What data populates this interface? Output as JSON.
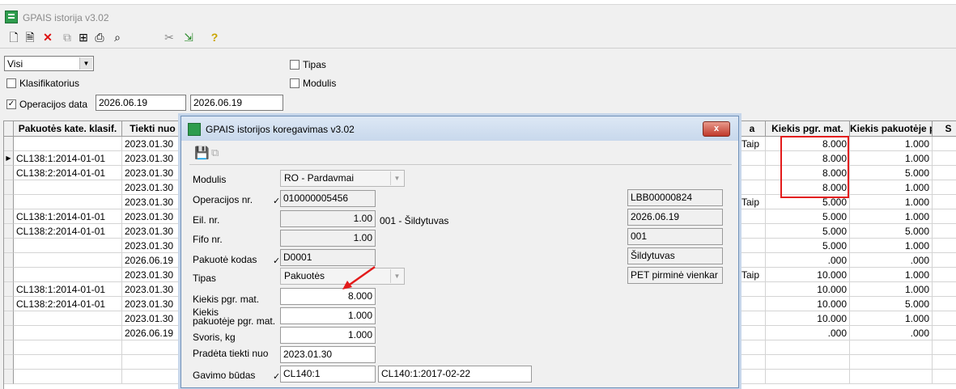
{
  "app": {
    "title": "GPAIS istorija v3.02",
    "toolbar_icons": [
      "new-icon",
      "document-icon",
      "delete-icon",
      "copy-icon",
      "tree-icon",
      "print-icon",
      "find-icon",
      "cut-tools-icon",
      "export-icon",
      "help-icon"
    ]
  },
  "filters": {
    "scope_select": "Visi",
    "tipas_label": "Tipas",
    "modulis_label": "Modulis",
    "klasifikatorius_label": "Klasifikatorius",
    "operacijos_data_label": "Operacijos data",
    "date_from": "2026.06.19",
    "date_to": "2026.06.19"
  },
  "grid": {
    "columns": [
      "Pakuotės kate. klasif.",
      "Tiekti nuo",
      "a",
      "Kiekis pgr. mat.",
      "Kiekis pakuotėje p",
      "S"
    ],
    "rows": [
      {
        "klasif": "",
        "tiekti": "2023.01.30",
        "a": "Taip",
        "kiekis": "8.000",
        "pak": "1.000"
      },
      {
        "klasif": "CL138:1:2014-01-01",
        "tiekti": "2023.01.30",
        "a": "",
        "kiekis": "8.000",
        "pak": "1.000"
      },
      {
        "klasif": "CL138:2:2014-01-01",
        "tiekti": "2023.01.30",
        "a": "",
        "kiekis": "8.000",
        "pak": "5.000"
      },
      {
        "klasif": "",
        "tiekti": "2023.01.30",
        "a": "",
        "kiekis": "8.000",
        "pak": "1.000"
      },
      {
        "klasif": "",
        "tiekti": "2023.01.30",
        "a": "Taip",
        "kiekis": "5.000",
        "pak": "1.000"
      },
      {
        "klasif": "CL138:1:2014-01-01",
        "tiekti": "2023.01.30",
        "a": "",
        "kiekis": "5.000",
        "pak": "1.000"
      },
      {
        "klasif": "CL138:2:2014-01-01",
        "tiekti": "2023.01.30",
        "a": "",
        "kiekis": "5.000",
        "pak": "5.000"
      },
      {
        "klasif": "",
        "tiekti": "2023.01.30",
        "a": "",
        "kiekis": "5.000",
        "pak": "1.000"
      },
      {
        "klasif": "",
        "tiekti": "2026.06.19",
        "a": "",
        "kiekis": ".000",
        "pak": ".000"
      },
      {
        "klasif": "",
        "tiekti": "2023.01.30",
        "a": "Taip",
        "kiekis": "10.000",
        "pak": "1.000"
      },
      {
        "klasif": "CL138:1:2014-01-01",
        "tiekti": "2023.01.30",
        "a": "",
        "kiekis": "10.000",
        "pak": "1.000"
      },
      {
        "klasif": "CL138:2:2014-01-01",
        "tiekti": "2023.01.30",
        "a": "",
        "kiekis": "10.000",
        "pak": "5.000"
      },
      {
        "klasif": "",
        "tiekti": "2023.01.30",
        "a": "",
        "kiekis": "10.000",
        "pak": "1.000"
      },
      {
        "klasif": "",
        "tiekti": "2026.06.19",
        "a": "",
        "kiekis": ".000",
        "pak": ".000"
      },
      {
        "klasif": "",
        "tiekti": "",
        "a": "",
        "kiekis": "",
        "pak": ""
      },
      {
        "klasif": "",
        "tiekti": "",
        "a": "",
        "kiekis": "",
        "pak": ""
      },
      {
        "klasif": "",
        "tiekti": "",
        "a": "",
        "kiekis": "",
        "pak": ""
      }
    ]
  },
  "dialog": {
    "title": "GPAIS istorijos koregavimas v3.02",
    "close": "x",
    "modulis_label": "Modulis",
    "modulis_value": "RO - Pardavmai",
    "operacijos_nr_label": "Operacijos nr.",
    "operacijos_nr_value": "010000005456",
    "eil_nr_label": "Eil. nr.",
    "eil_nr_value": "1.00",
    "eil_desc": "001 - Šildytuvas",
    "fifo_label": "Fifo nr.",
    "fifo_value": "1.00",
    "pakuote_kodas_label": "Pakuotė kodas",
    "pakuote_kodas_value": "D0001",
    "tipas_label": "Tipas",
    "tipas_value": "Pakuotės",
    "kiekis_pgr_label": "Kiekis pgr. mat.",
    "kiekis_pgr_value": "8.000",
    "kiekis_pak_label_1": "Kiekis",
    "kiekis_pak_label_2": "pakuotėje pgr. mat.",
    "kiekis_pak_value": "1.000",
    "svoris_label": "Svoris, kg",
    "svoris_value": "1.000",
    "pradeta_label": "Pradėta tiekti nuo",
    "pradeta_value": "2023.01.30",
    "gavimo_label": "Gavimo būdas",
    "gavimo_value": "CL140:1",
    "gavimo_desc": "CL140:1:2017-02-22",
    "side_fields": [
      "LBB00000824",
      "2026.06.19",
      "001",
      "Šildytuvas",
      "PET pirminė vienkar"
    ]
  },
  "colors": {
    "highlight": "#e31b1b",
    "dialog_border": "#6f90b8"
  }
}
